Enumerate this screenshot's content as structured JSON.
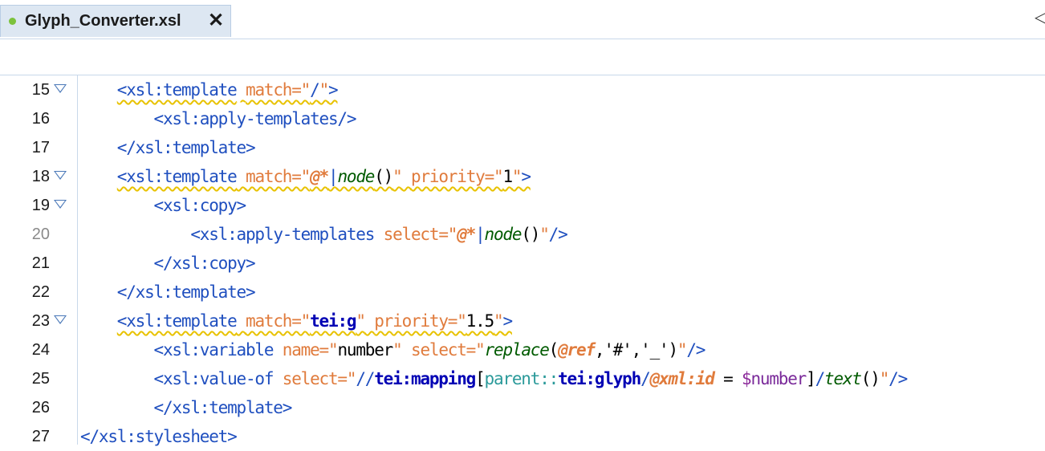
{
  "tab": {
    "title": "Glyph_Converter.xsl",
    "close_glyph": "✕",
    "status_color": "#7cc23c"
  },
  "panel": {
    "collapse_glyph": "◁"
  },
  "editor": {
    "lines": [
      {
        "number": "15",
        "foldable": true,
        "indent": "    ",
        "tokens": [
          {
            "t": "<xsl:template",
            "c": "b",
            "sq": true
          },
          {
            "t": " ",
            "c": "v",
            "sq": true
          },
          {
            "t": "match=\"",
            "c": "a",
            "sq": true
          },
          {
            "t": "/",
            "c": "b",
            "sq": true
          },
          {
            "t": "\"",
            "c": "a",
            "sq": true
          },
          {
            "t": ">",
            "c": "b",
            "sq": true
          }
        ]
      },
      {
        "number": "16",
        "foldable": false,
        "indent": "        ",
        "tokens": [
          {
            "t": "<xsl:apply-templates/>",
            "c": "b"
          }
        ]
      },
      {
        "number": "17",
        "foldable": false,
        "indent": "    ",
        "tokens": [
          {
            "t": "</xsl:template>",
            "c": "b"
          }
        ]
      },
      {
        "number": "18",
        "foldable": true,
        "indent": "    ",
        "tokens": [
          {
            "t": "<xsl:template",
            "c": "b",
            "sq": true
          },
          {
            "t": " ",
            "c": "v",
            "sq": true
          },
          {
            "t": "match=\"",
            "c": "a",
            "sq": true
          },
          {
            "t": "@*",
            "c": "s",
            "sq": true
          },
          {
            "t": "|",
            "c": "p",
            "sq": true
          },
          {
            "t": "node",
            "c": "f",
            "sq": true
          },
          {
            "t": "()",
            "c": "v",
            "sq": true
          },
          {
            "t": "\"",
            "c": "a",
            "sq": true
          },
          {
            "t": " ",
            "c": "v",
            "sq": true
          },
          {
            "t": "priority=\"",
            "c": "a",
            "sq": true
          },
          {
            "t": "1",
            "c": "v",
            "sq": true
          },
          {
            "t": "\"",
            "c": "a",
            "sq": true
          },
          {
            "t": ">",
            "c": "b",
            "sq": true
          }
        ]
      },
      {
        "number": "19",
        "foldable": true,
        "indent": "        ",
        "tokens": [
          {
            "t": "<xsl:copy>",
            "c": "b"
          }
        ]
      },
      {
        "number": "20",
        "foldable": false,
        "gray": true,
        "indent": "            ",
        "tokens": [
          {
            "t": "<xsl:apply-templates",
            "c": "b"
          },
          {
            "t": " ",
            "c": "v"
          },
          {
            "t": "select=\"",
            "c": "a"
          },
          {
            "t": "@*",
            "c": "s"
          },
          {
            "t": "|",
            "c": "p"
          },
          {
            "t": "node",
            "c": "f"
          },
          {
            "t": "()",
            "c": "v"
          },
          {
            "t": "\"",
            "c": "a"
          },
          {
            "t": "/>",
            "c": "b"
          }
        ]
      },
      {
        "number": "21",
        "foldable": false,
        "indent": "        ",
        "tokens": [
          {
            "t": "</xsl:copy>",
            "c": "b"
          }
        ]
      },
      {
        "number": "22",
        "foldable": false,
        "indent": "    ",
        "tokens": [
          {
            "t": "</xsl:template>",
            "c": "b"
          }
        ]
      },
      {
        "number": "23",
        "foldable": true,
        "indent": "    ",
        "tokens": [
          {
            "t": "<xsl:template",
            "c": "b",
            "sq": true
          },
          {
            "t": " ",
            "c": "v",
            "sq": true
          },
          {
            "t": "match=\"",
            "c": "a",
            "sq": true
          },
          {
            "t": "tei:g",
            "c": "k",
            "sq": true
          },
          {
            "t": "\"",
            "c": "a",
            "sq": true
          },
          {
            "t": " ",
            "c": "v",
            "sq": true
          },
          {
            "t": "priority=\"",
            "c": "a",
            "sq": true
          },
          {
            "t": "1.5",
            "c": "v",
            "sq": true
          },
          {
            "t": "\"",
            "c": "a",
            "sq": true
          },
          {
            "t": ">",
            "c": "b",
            "sq": true
          }
        ]
      },
      {
        "number": "24",
        "foldable": false,
        "indent": "        ",
        "tokens": [
          {
            "t": "<xsl:variable",
            "c": "b"
          },
          {
            "t": " ",
            "c": "v"
          },
          {
            "t": "name=\"",
            "c": "a"
          },
          {
            "t": "number",
            "c": "v"
          },
          {
            "t": "\"",
            "c": "a"
          },
          {
            "t": " ",
            "c": "v"
          },
          {
            "t": "select=\"",
            "c": "a"
          },
          {
            "t": "replace",
            "c": "f"
          },
          {
            "t": "(",
            "c": "v"
          },
          {
            "t": "@ref",
            "c": "s"
          },
          {
            "t": ",'#','_')",
            "c": "v"
          },
          {
            "t": "\"",
            "c": "a"
          },
          {
            "t": "/>",
            "c": "b"
          }
        ]
      },
      {
        "number": "25",
        "foldable": false,
        "indent": "        ",
        "tokens": [
          {
            "t": "<xsl:value-of",
            "c": "b"
          },
          {
            "t": " ",
            "c": "v"
          },
          {
            "t": "select=\"",
            "c": "a"
          },
          {
            "t": "//",
            "c": "p"
          },
          {
            "t": "tei:mapping",
            "c": "k"
          },
          {
            "t": "[",
            "c": "v"
          },
          {
            "t": "parent::",
            "c": "ax"
          },
          {
            "t": "tei:glyph",
            "c": "k"
          },
          {
            "t": "/",
            "c": "p"
          },
          {
            "t": "@xml:id",
            "c": "s"
          },
          {
            "t": " = ",
            "c": "v"
          },
          {
            "t": "$",
            "c": "var"
          },
          {
            "t": "number",
            "c": "vn"
          },
          {
            "t": "]",
            "c": "v"
          },
          {
            "t": "/",
            "c": "p"
          },
          {
            "t": "text",
            "c": "f"
          },
          {
            "t": "()",
            "c": "v"
          },
          {
            "t": "\"",
            "c": "a"
          },
          {
            "t": "/>",
            "c": "b"
          }
        ]
      },
      {
        "number": "26",
        "foldable": false,
        "indent": "        ",
        "tokens": [
          {
            "t": "</xsl:template>",
            "c": "b"
          }
        ]
      },
      {
        "number": "27",
        "foldable": false,
        "indent": "",
        "tokens": [
          {
            "t": "</xsl:stylesheet>",
            "c": "b"
          }
        ]
      }
    ]
  }
}
